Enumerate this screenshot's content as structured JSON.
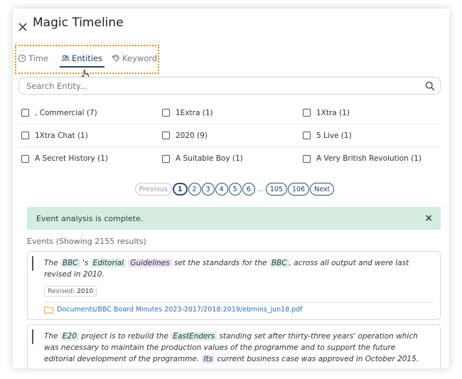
{
  "header": {
    "title": "Magic Timeline",
    "close_icon": "close-icon"
  },
  "tabs": [
    {
      "label": "Time",
      "icon": "clock-icon",
      "active": false
    },
    {
      "label": "Entities",
      "icon": "people-icon",
      "active": true
    },
    {
      "label": "Keyword",
      "icon": "tags-icon",
      "active": false
    }
  ],
  "search": {
    "placeholder": "Search Entity...",
    "value": "",
    "icon": "search-icon"
  },
  "entities": [
    [
      ", Commercial (7)",
      "1Extra (1)",
      "1Xtra (1)"
    ],
    [
      "1Xtra Chat (1)",
      "2020 (9)",
      "5 Live (1)"
    ],
    [
      "A Secret History (1)",
      "A Suitable Boy (1)",
      "A Very British Revolution (1)"
    ]
  ],
  "pagination": {
    "previous": "Previous",
    "pages": [
      "1",
      "2",
      "3",
      "4",
      "5",
      "6"
    ],
    "ellipsis": "...",
    "last_pages": [
      "105",
      "106"
    ],
    "next": "Next",
    "current": "1"
  },
  "alert": {
    "text": "Event analysis is complete.",
    "close": "×"
  },
  "events": {
    "heading": "Events (Showing 2155 results)",
    "items": [
      {
        "segments": [
          {
            "text": "The "
          },
          {
            "text": "BBC",
            "tag": "teal"
          },
          {
            "text": " 's "
          },
          {
            "text": "Editorial",
            "tag": "teal"
          },
          {
            "text": " "
          },
          {
            "text": "Guidelines",
            "tag": "purple"
          },
          {
            "text": " set the standards for the "
          },
          {
            "text": "BBC",
            "tag": "teal"
          },
          {
            "text": ", across all output and were last revised in 2010."
          }
        ],
        "revised_label": "Revised:",
        "revised_value": "2010",
        "file_icon": "folder-icon",
        "file": "Documents/BBC Board Minutes 2023-2017/2018:2019/ebmins_jun18.pdf"
      },
      {
        "segments": [
          {
            "text": "The "
          },
          {
            "text": "E20",
            "tag": "teal"
          },
          {
            "text": " project is to rebuild the "
          },
          {
            "text": "EastEnders",
            "tag": "teal"
          },
          {
            "text": " standing set after thirty-three years' operation which was necessary to maintain the production values of the programme and to support the future editorial development of the programme. "
          },
          {
            "text": "Its",
            "tag": "purple"
          },
          {
            "text": " current business case was approved in October 2015."
          }
        ]
      }
    ]
  },
  "colors": {
    "accent": "#1f3f67",
    "highlight_box": "#e39012",
    "alert_bg": "#d5ecdf",
    "tag_teal": "#d8f0ec",
    "tag_purple": "#ebe0f5",
    "link": "#2e6fb7"
  }
}
